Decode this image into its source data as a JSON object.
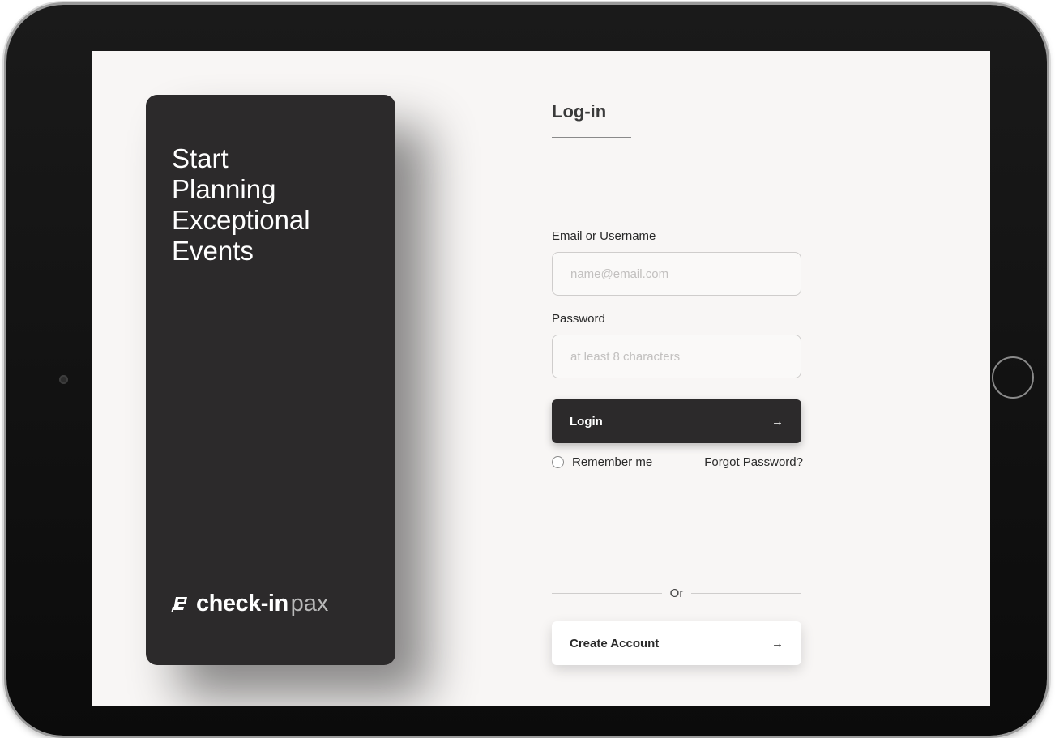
{
  "hero": {
    "headline_lines": [
      "Start",
      "Planning",
      "Exceptional",
      "Events"
    ],
    "logo": {
      "strong": "check-in",
      "light": "pax"
    }
  },
  "login": {
    "title": "Log-in",
    "email": {
      "label": "Email or Username",
      "placeholder": "name@email.com",
      "value": ""
    },
    "password": {
      "label": "Password",
      "placeholder": "at least 8 characters",
      "value": ""
    },
    "login_button": {
      "label": "Login",
      "arrow": "→"
    },
    "remember_me": {
      "label": "Remember me",
      "checked": false
    },
    "forgot_password": "Forgot Password?",
    "divider_text": "Or",
    "create_account_button": {
      "label": "Create Account",
      "arrow": "→"
    }
  },
  "colors": {
    "hero_background": "#2c2a2b",
    "screen_background": "#f8f6f5",
    "primary_button": "#2c2a2b",
    "text": "#2a2a2a"
  },
  "icons": {
    "logo_mark": "check-in-pax-logo-icon"
  }
}
